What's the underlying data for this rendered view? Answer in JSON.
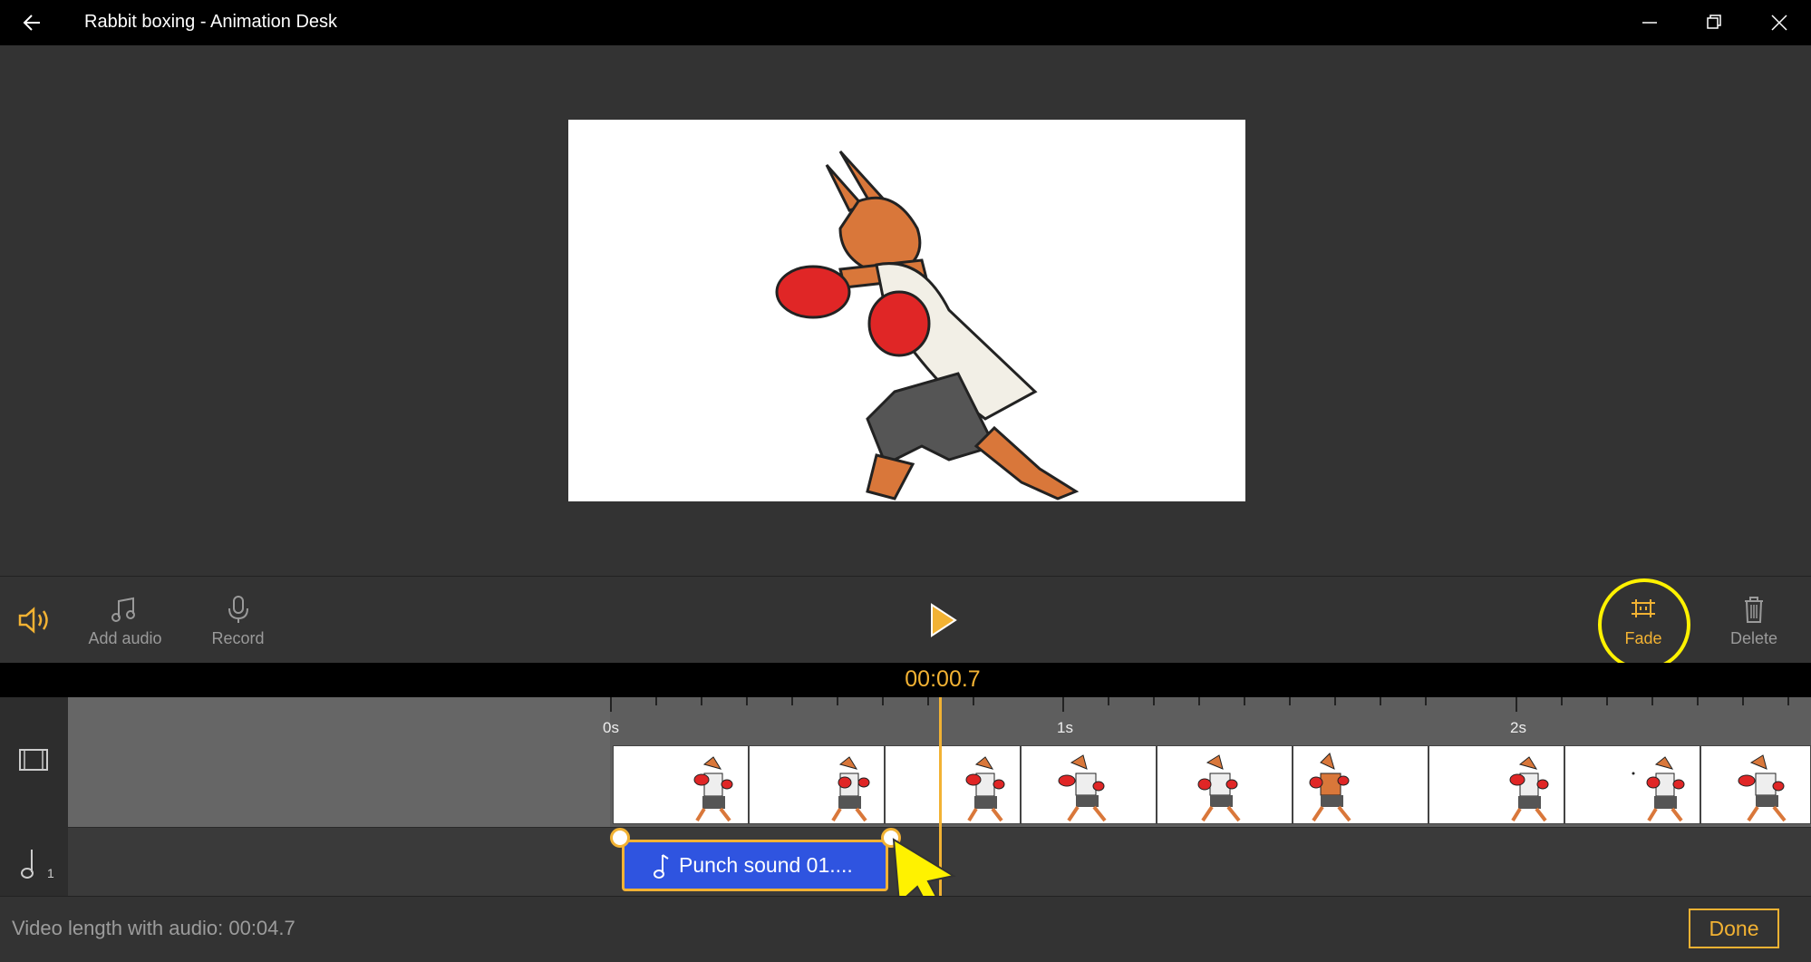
{
  "window": {
    "title": "Rabbit boxing - Animation Desk"
  },
  "toolbar": {
    "add_audio_label": "Add audio",
    "record_label": "Record",
    "fade_label": "Fade",
    "delete_label": "Delete"
  },
  "timeline": {
    "timecode": "00:00.7",
    "ruler_labels": [
      "0s",
      "1s",
      "2s"
    ],
    "audio_track_number": "1",
    "audio_clip_label": "Punch sound 01...."
  },
  "status": {
    "video_length_label": "Video length with audio:",
    "video_length_value": "00:04.7",
    "done_label": "Done"
  },
  "colors": {
    "accent": "#f2b233",
    "clip_blue": "#2f54e0",
    "highlight": "#fff200"
  }
}
